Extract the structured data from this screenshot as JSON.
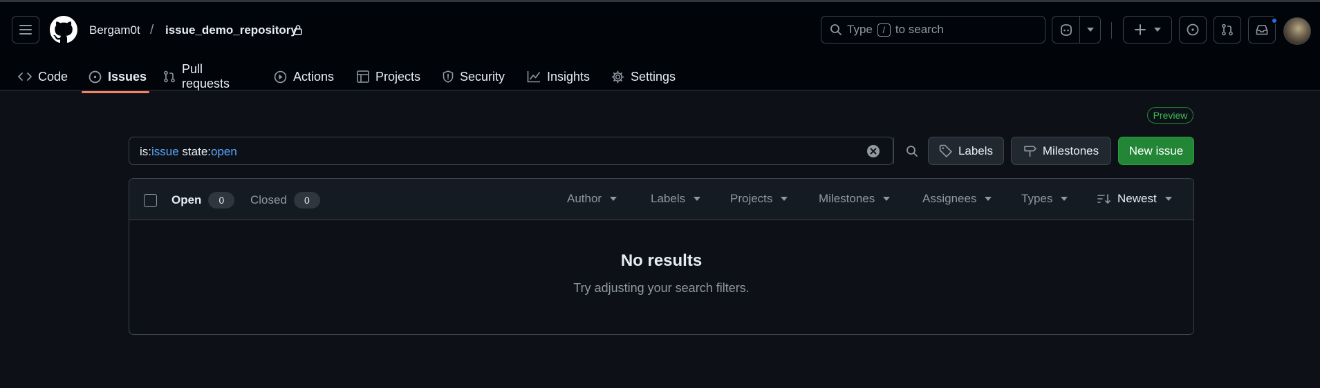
{
  "header": {
    "owner": "Bergam0t",
    "separator": "/",
    "repo": "issue_demo_repository",
    "search": {
      "before": "Type",
      "key": "/",
      "after": "to search"
    }
  },
  "tabs": [
    {
      "label": "Code",
      "icon": "code-icon"
    },
    {
      "label": "Issues",
      "icon": "issue-opened-icon",
      "active": true
    },
    {
      "label": "Pull requests",
      "icon": "git-pull-request-icon"
    },
    {
      "label": "Actions",
      "icon": "play-icon"
    },
    {
      "label": "Projects",
      "icon": "table-icon"
    },
    {
      "label": "Security",
      "icon": "shield-icon"
    },
    {
      "label": "Insights",
      "icon": "graph-icon"
    },
    {
      "label": "Settings",
      "icon": "gear-icon"
    }
  ],
  "preview_badge": "Preview",
  "filter": {
    "k1": "is:",
    "v1": "issue",
    "sp": " ",
    "k2": "state:",
    "v2": "open"
  },
  "buttons": {
    "labels": "Labels",
    "milestones": "Milestones",
    "new_issue": "New issue"
  },
  "list": {
    "open_label": "Open",
    "open_count": "0",
    "closed_label": "Closed",
    "closed_count": "0",
    "filters": [
      "Author",
      "Labels",
      "Projects",
      "Milestones",
      "Assignees",
      "Types"
    ],
    "sort": "Newest"
  },
  "empty": {
    "title": "No results",
    "subtitle": "Try adjusting your search filters."
  },
  "colors": {
    "accent_underline": "#f78166",
    "primary_button": "#238636",
    "link_blue": "#58a6ff",
    "notification": "#1f6feb"
  }
}
